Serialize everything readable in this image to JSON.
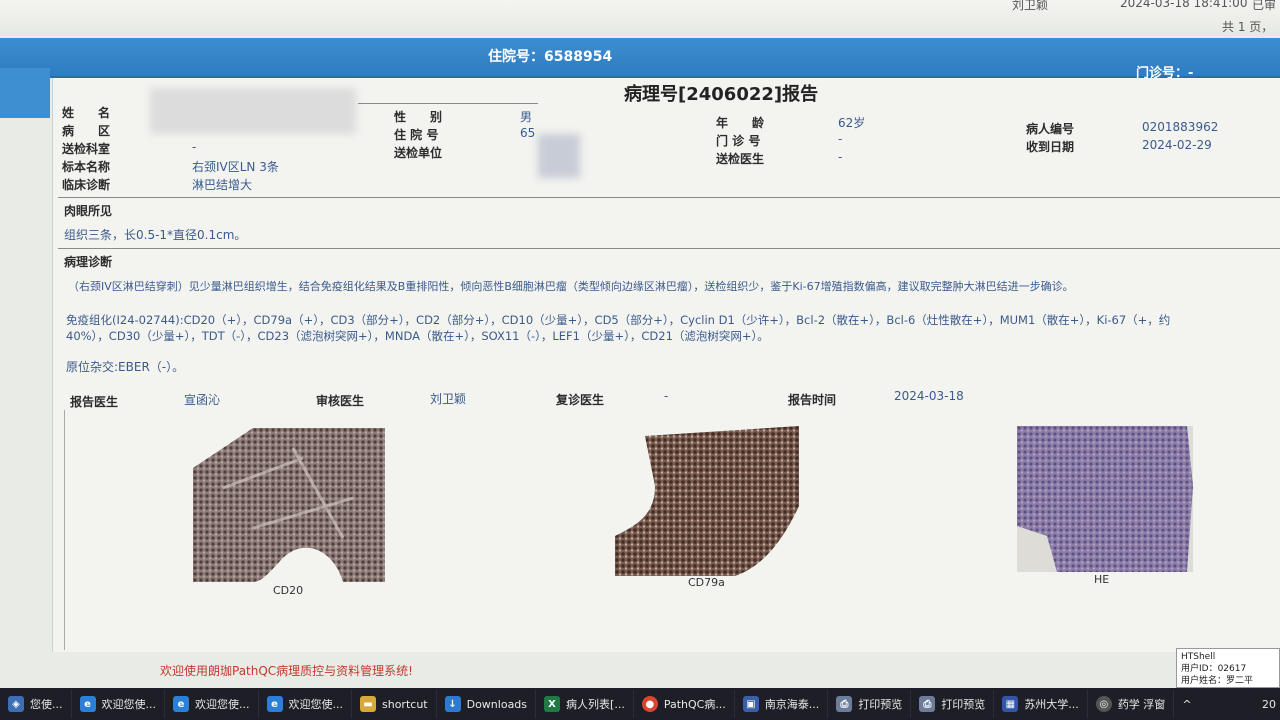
{
  "topbar": {
    "user": "刘卫颖",
    "datetime": "2024-03-18 18:41:00",
    "status": "已审"
  },
  "pagination": "共 1 页，共",
  "header": {
    "admission_label": "住院号",
    "admission_value": "6588954",
    "clinic_label": "门诊号",
    "clinic_value": "-"
  },
  "report": {
    "title": "病理号[2406022]报告",
    "fields": {
      "name_label": "姓　　名",
      "ward_label": "病　　区",
      "dept_label": "送检科室",
      "dept_value": "-",
      "specimen_label": "标本名称",
      "specimen_value": "右颈IV区LN 3条",
      "diagnosis_label": "临床诊断",
      "diagnosis_value": "淋巴结增大",
      "sex_label": "性　　别",
      "sex_value": "男",
      "inpatient_label": "住 院 号",
      "inpatient_value": "65",
      "unit_label": "送检单位",
      "age_label": "年　　龄",
      "age_value": "62岁",
      "clinic_no_label": "门 诊 号",
      "clinic_no_value": "-",
      "doctor_label": "送检医生",
      "doctor_value": "-",
      "patient_id_label": "病人编号",
      "patient_id_value": "0201883962",
      "received_label": "收到日期",
      "received_value": "2024-02-29"
    },
    "gross": {
      "title": "肉眼所见",
      "text": "组织三条，长0.5-1*直径0.1cm。"
    },
    "diagnosis": {
      "title": "病理诊断",
      "line1": "（右颈IV区淋巴结穿刺）见少量淋巴组织增生，结合免疫组化结果及B重排阳性，倾向恶性B细胞淋巴瘤（类型倾向边缘区淋巴瘤），送检组织少，鉴于Ki-67增殖指数偏高，建议取完整肿大淋巴结进一步确诊。",
      "ihc1": "免疫组化(I24-02744):CD20（+），CD79a（+），CD3（部分+），CD2（部分+），CD10（少量+），CD5（部分+），Cyclin D1（少许+），Bcl-2（散在+），Bcl-6（灶性散在+），MUM1（散在+），Ki-67（+，约",
      "ihc2": "40%），CD30（少量+），TDT（-），CD23（滤泡树突网+），MNDA（散在+），SOX11（-），LEF1（少量+），CD21（滤泡树突网+）。",
      "ish": "原位杂交:EBER（-）。"
    },
    "signoff": {
      "reporter_label": "报告医生",
      "reporter_value": "宣函沁",
      "reviewer_label": "审核医生",
      "reviewer_value": "刘卫颖",
      "recheck_label": "复诊医生",
      "recheck_value": "-",
      "time_label": "报告时间",
      "time_value": "2024-03-18"
    },
    "images": [
      {
        "caption": "CD20"
      },
      {
        "caption": "CD79a"
      },
      {
        "caption": "HE"
      }
    ]
  },
  "footer_message": "欢迎使用朗珈PathQC病理质控与资料管理系统!",
  "htshell": {
    "title": "HTShell",
    "user_id": "用户ID：02617",
    "user_name": "用户姓名：罗二平"
  },
  "taskbar": {
    "items": [
      {
        "label": "您使...",
        "icon": "windows-icon"
      },
      {
        "label": "欢迎您使...",
        "icon": "ie-icon"
      },
      {
        "label": "欢迎您使...",
        "icon": "ie-icon"
      },
      {
        "label": "欢迎您使...",
        "icon": "ie-icon"
      },
      {
        "label": "shortcut",
        "icon": "folder-icon"
      },
      {
        "label": "Downloads",
        "icon": "download-icon"
      },
      {
        "label": "病人列表[...",
        "icon": "excel-icon"
      },
      {
        "label": "PathQC病...",
        "icon": "chrome-icon"
      },
      {
        "label": "南京海泰...",
        "icon": "app-icon"
      },
      {
        "label": "打印预览",
        "icon": "print-icon"
      },
      {
        "label": "打印预览",
        "icon": "print-icon"
      },
      {
        "label": "苏州大学...",
        "icon": "app-icon"
      },
      {
        "label": "药学 浮窗",
        "icon": "app-icon"
      }
    ],
    "tray": "^",
    "time_fragment": "20"
  },
  "colors": {
    "accent_blue": "#2f7cc0",
    "value_blue": "#3a5a8c",
    "footer_red": "#c23a2a"
  }
}
